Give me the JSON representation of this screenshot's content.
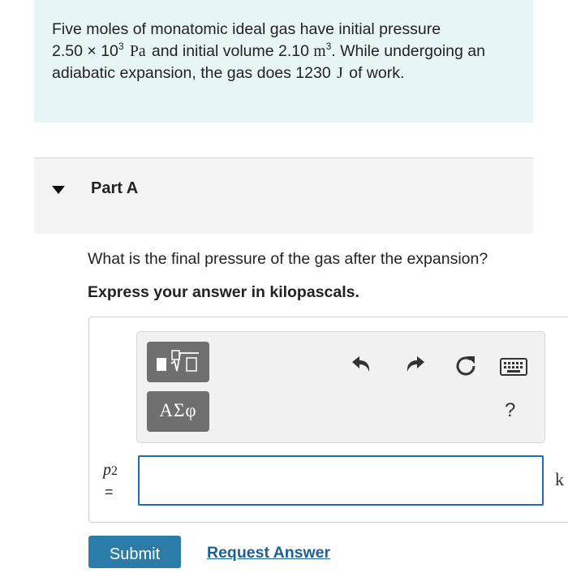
{
  "problem": {
    "line1": "Five moles of monatomic ideal gas have initial pressure",
    "pressure_mantissa": "2.50",
    "times": "×",
    "pressure_base": "10",
    "pressure_exp": "3",
    "pressure_unit": "Pa",
    "mid_text": "and initial volume 2.10",
    "volume_unit": "m",
    "volume_exp": "3",
    "after_volume": ". While undergoing an adiabatic expansion, the gas does 1230",
    "work_unit": "J",
    "end_text": "of work."
  },
  "part": {
    "title": "Part A",
    "question": "What is the final pressure of the gas after the expansion?",
    "instruction": "Express your answer in kilopascals."
  },
  "toolbar": {
    "template_icon": "templates-icon",
    "symbols_label": "ΑΣφ",
    "undo_icon": "undo-icon",
    "redo_icon": "redo-icon",
    "reset_icon": "reset-icon",
    "keyboard_icon": "keyboard-icon",
    "help_label": "?"
  },
  "answer": {
    "variable": "p",
    "variable_sub": "2",
    "equals": "=",
    "value": "",
    "unit_partial": "k"
  },
  "actions": {
    "submit_label": "Submit",
    "request_label": "Request Answer"
  },
  "colors": {
    "intro_bg": "#e8f5f7",
    "submit_bg": "#2b7ca8",
    "input_border": "#1d6fa5",
    "link": "#1d5f97"
  }
}
